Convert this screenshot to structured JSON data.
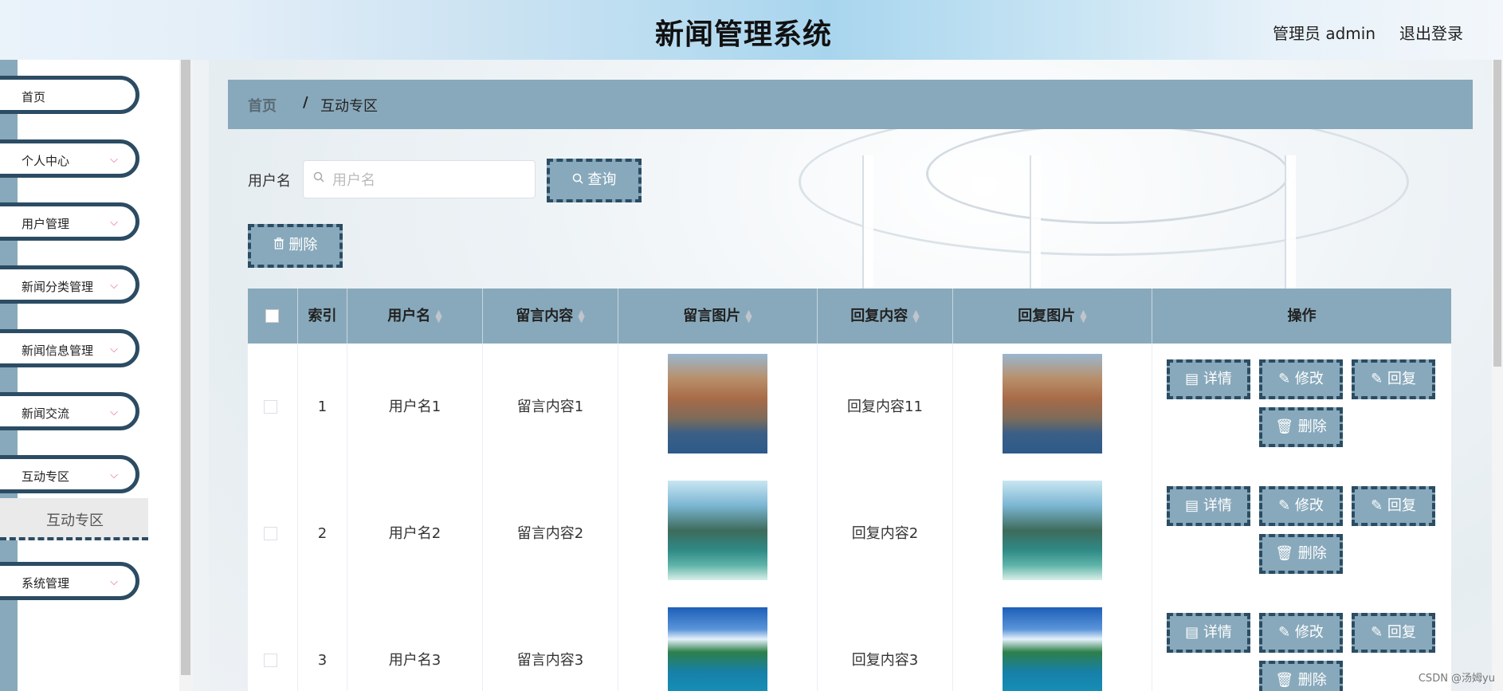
{
  "header": {
    "title": "新闻管理系统",
    "user": "管理员 admin",
    "logout": "退出登录"
  },
  "sidebar": {
    "items": [
      {
        "label": "首页"
      },
      {
        "label": "个人中心"
      },
      {
        "label": "用户管理"
      },
      {
        "label": "新闻分类管理"
      },
      {
        "label": "新闻信息管理"
      },
      {
        "label": "新闻交流"
      },
      {
        "label": "互动专区"
      },
      {
        "label": "系统管理"
      }
    ],
    "submenu": "互动专区",
    "chevron": "⌵"
  },
  "breadcrumb": {
    "home": "首页",
    "sep": "/",
    "current": "互动专区"
  },
  "search": {
    "label": "用户名",
    "placeholder": "用户名",
    "button": "查询"
  },
  "toolbar": {
    "delete": "删除"
  },
  "table": {
    "headers": [
      "索引",
      "用户名",
      "留言内容",
      "留言图片",
      "回复内容",
      "回复图片",
      "操作"
    ],
    "rows": [
      {
        "index": "1",
        "username": "用户名1",
        "message": "留言内容1",
        "reply": "回复内容11",
        "image": "coastal-town-photo"
      },
      {
        "index": "2",
        "username": "用户名2",
        "message": "留言内容2",
        "reply": "回复内容2",
        "image": "mountain-lake-photo"
      },
      {
        "index": "3",
        "username": "用户名3",
        "message": "留言内容3",
        "reply": "回复内容3",
        "image": "tropical-island-photo"
      }
    ],
    "actions": {
      "detail": "详情",
      "edit": "修改",
      "reply": "回复",
      "delete": "删除"
    }
  },
  "watermark": "CSDN @汤姆yu",
  "colors": {
    "accent": "#88a9bb",
    "border": "#2b4c63",
    "chevron": "#e0548a"
  }
}
